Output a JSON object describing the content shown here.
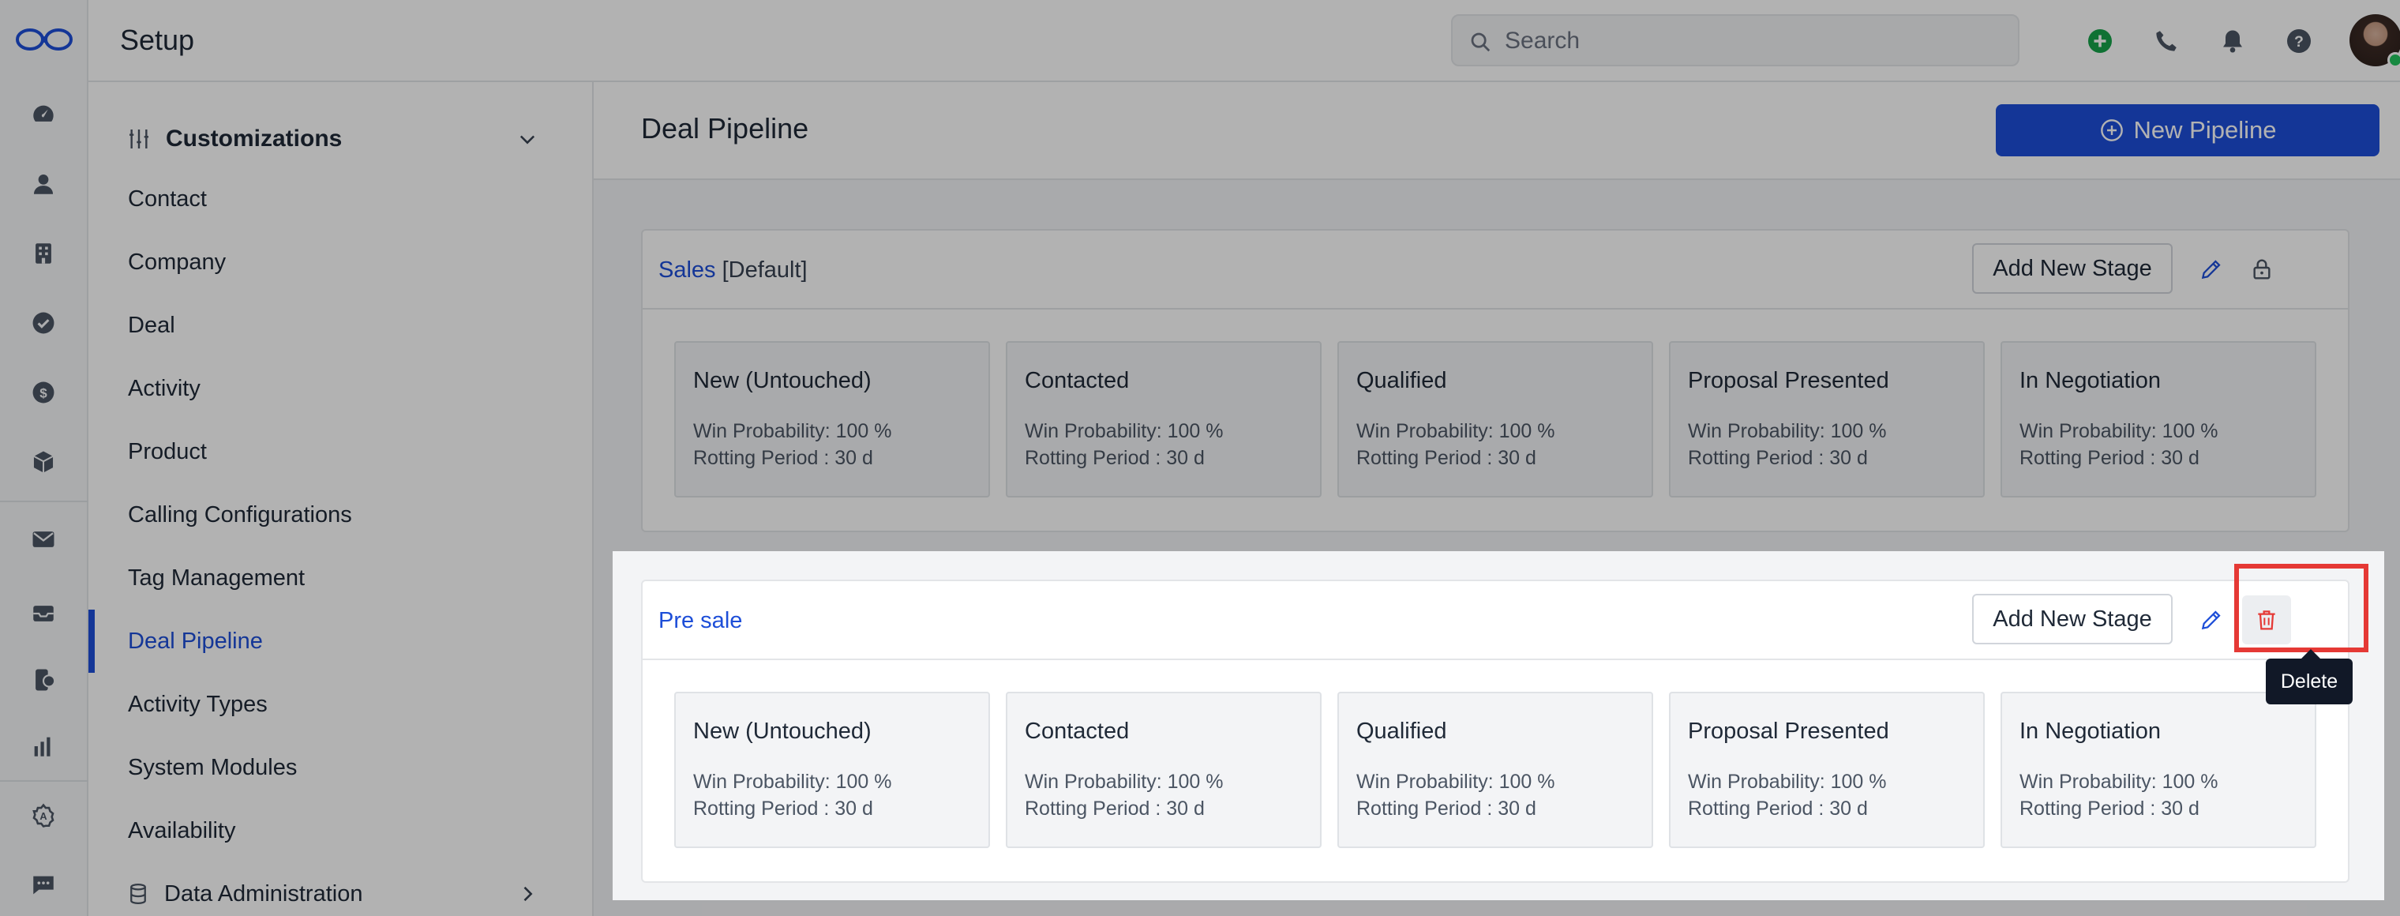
{
  "app": {
    "title": "Setup"
  },
  "search": {
    "placeholder": "Search"
  },
  "sidebar": {
    "header": "Customizations",
    "items": [
      {
        "label": "Contact"
      },
      {
        "label": "Company"
      },
      {
        "label": "Deal"
      },
      {
        "label": "Activity"
      },
      {
        "label": "Product"
      },
      {
        "label": "Calling Configurations"
      },
      {
        "label": "Tag Management"
      },
      {
        "label": "Deal Pipeline"
      },
      {
        "label": "Activity Types"
      },
      {
        "label": "System Modules"
      },
      {
        "label": "Availability"
      }
    ],
    "active": "Deal Pipeline",
    "footer": "Data Administration"
  },
  "main": {
    "title": "Deal Pipeline",
    "new_pipeline_label": "New Pipeline"
  },
  "pipelines": [
    {
      "name": "Sales",
      "tag": "[Default]",
      "add_stage_label": "Add New Stage",
      "stages": [
        {
          "name": "New (Untouched)",
          "win": "Win Probability: 100 %",
          "rot": "Rotting Period : 30 d"
        },
        {
          "name": "Contacted",
          "win": "Win Probability: 100 %",
          "rot": "Rotting Period : 30 d"
        },
        {
          "name": "Qualified",
          "win": "Win Probability: 100 %",
          "rot": "Rotting Period : 30 d"
        },
        {
          "name": "Proposal Presented",
          "win": "Win Probability: 100 %",
          "rot": "Rotting Period : 30 d"
        },
        {
          "name": "In Negotiation",
          "win": "Win Probability: 100 %",
          "rot": "Rotting Period : 30 d"
        }
      ]
    },
    {
      "name": "Pre sale",
      "tag": "",
      "add_stage_label": "Add New Stage",
      "stages": [
        {
          "name": "New (Untouched)",
          "win": "Win Probability: 100 %",
          "rot": "Rotting Period : 30 d"
        },
        {
          "name": "Contacted",
          "win": "Win Probability: 100 %",
          "rot": "Rotting Period : 30 d"
        },
        {
          "name": "Qualified",
          "win": "Win Probability: 100 %",
          "rot": "Rotting Period : 30 d"
        },
        {
          "name": "Proposal Presented",
          "win": "Win Probability: 100 %",
          "rot": "Rotting Period : 30 d"
        },
        {
          "name": "In Negotiation",
          "win": "Win Probability: 100 %",
          "rot": "Rotting Period : 30 d"
        }
      ]
    }
  ],
  "tooltip": {
    "text": "Delete"
  },
  "colors": {
    "accent": "#1d4ed8",
    "delete": "#e53935",
    "add": "#16a34a"
  },
  "icons": {
    "rail": [
      "dashboard-icon",
      "contact-icon",
      "company-icon",
      "activity-check-icon",
      "deal-dollar-icon",
      "product-box-icon",
      "mail-icon",
      "inbox-icon",
      "phone-chat-icon",
      "reports-icon",
      "automation-icon",
      "chat-icon"
    ],
    "top": [
      "add-circle-icon",
      "phone-icon",
      "bell-icon",
      "help-icon"
    ]
  }
}
